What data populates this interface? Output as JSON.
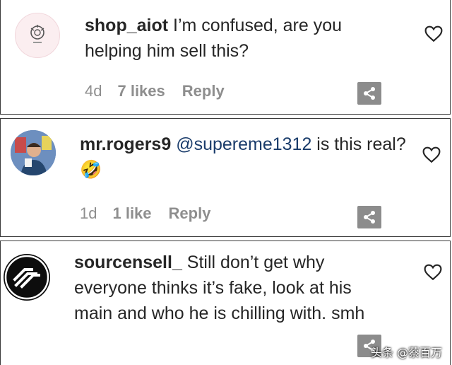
{
  "comments": [
    {
      "username": "shop_aiot",
      "text": " I’m confused, are you helping him sell this?",
      "time": "4d",
      "likes": "7 likes",
      "reply": "Reply"
    },
    {
      "username": "mr.rogers9",
      "mention": " @supereme1312",
      "text": " is this real? ",
      "emoji": "🤣",
      "time": "1d",
      "likes": "1 like",
      "reply": "Reply"
    },
    {
      "username": "sourcensell_",
      "text": " Still don’t get why everyone thinks it’s fake, look at his main and who he is chilling with. smh"
    }
  ],
  "watermark": "头条 @蔡百万",
  "icons": {
    "like": "heart-outline-icon",
    "share": "share-icon"
  },
  "colors": {
    "text": "#262626",
    "meta": "#8e8e8e",
    "mention": "#1a3c6b",
    "share_bg": "#8c8c8c"
  }
}
